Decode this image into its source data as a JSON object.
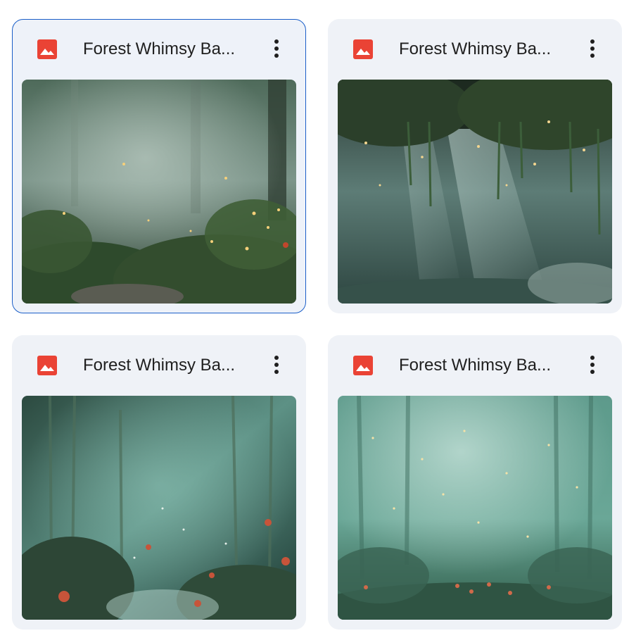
{
  "files": [
    {
      "title": "Forest Whimsy Ba...",
      "icon": "image-file-icon",
      "selected": true
    },
    {
      "title": "Forest Whimsy Ba...",
      "icon": "image-file-icon",
      "selected": false
    },
    {
      "title": "Forest Whimsy Ba...",
      "icon": "image-file-icon",
      "selected": false
    },
    {
      "title": "Forest Whimsy Ba...",
      "icon": "image-file-icon",
      "selected": false
    }
  ],
  "colors": {
    "card_bg": "#eff2f7",
    "selected_border": "#1a5ec8",
    "image_icon_red": "#ea4335",
    "title_text": "#1f1f1f"
  }
}
